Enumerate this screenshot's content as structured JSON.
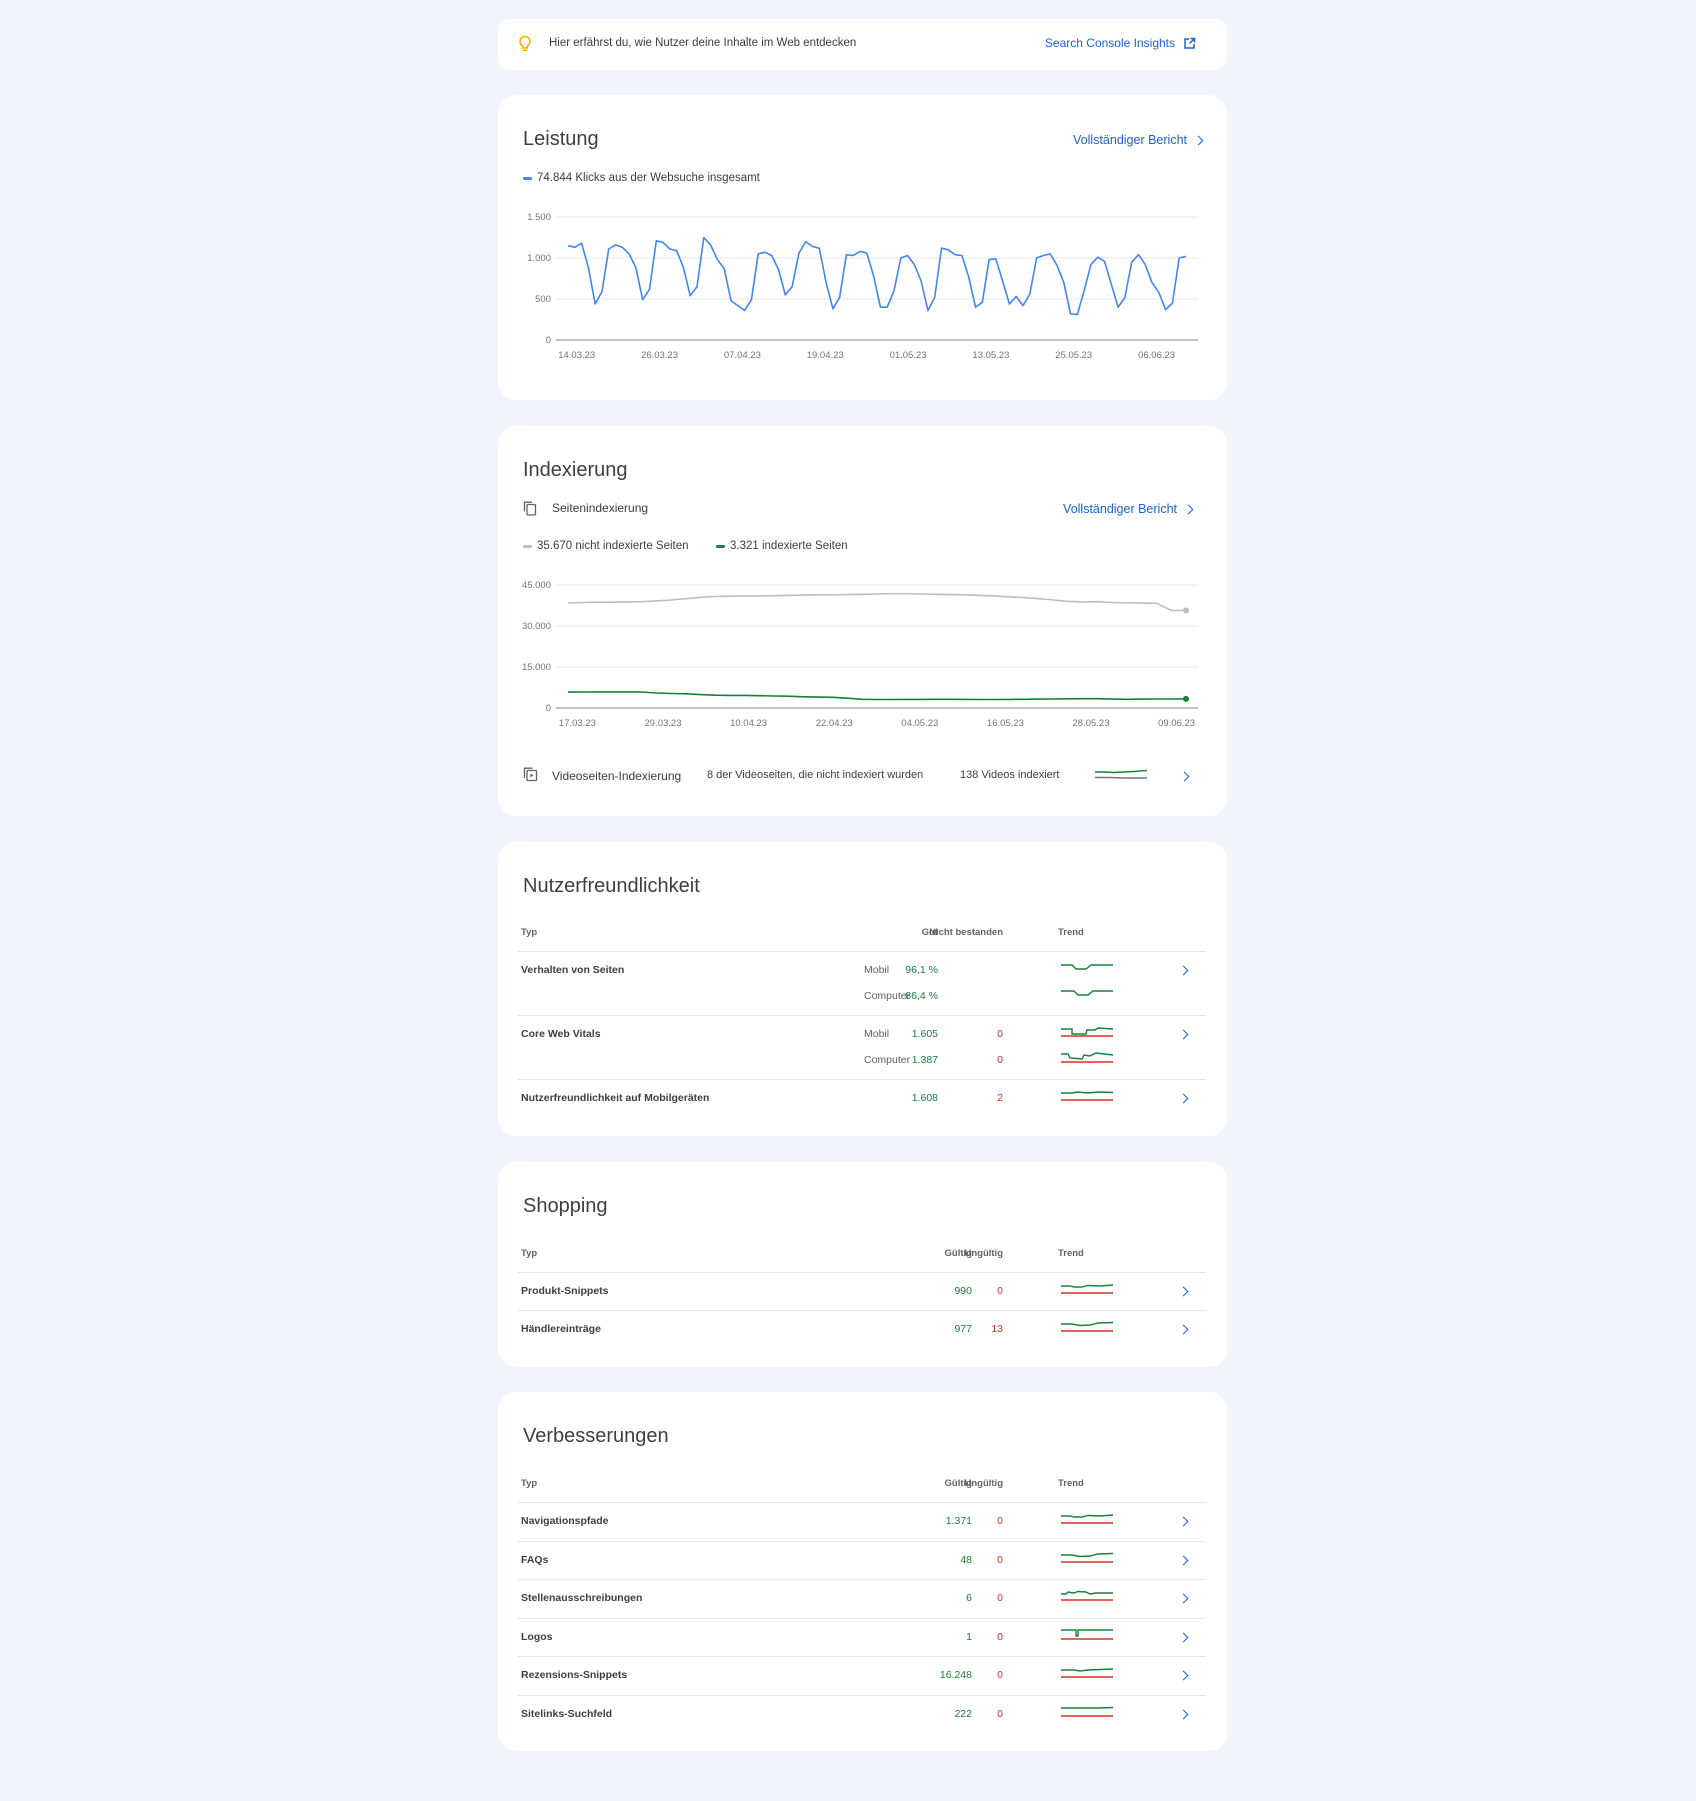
{
  "insights_banner": {
    "text": "Hier erfährst du, wie Nutzer deine Inhalte im Web entdecken",
    "link": "Search Console Insights",
    "icon": "lightbulb-icon"
  },
  "performance": {
    "title": "Leistung",
    "full_report": "Vollständiger Bericht",
    "legend": "74.844 Klicks aus der Websuche insgesamt",
    "series_color": "#4285f4",
    "chart_data": {
      "type": "line",
      "ylim": [
        0,
        1500
      ],
      "y_ticks": [
        "0",
        "500",
        "1.000",
        "1.500"
      ],
      "x_ticks": [
        "14.03.23",
        "26.03.23",
        "07.04.23",
        "19.04.23",
        "01.05.23",
        "13.05.23",
        "25.05.23",
        "06.06.23"
      ],
      "x_start": "11.03.23",
      "x_end": "12.06.23",
      "series": [
        {
          "name": "Klicks",
          "values": [
            1150,
            1130,
            1180,
            880,
            440,
            590,
            1110,
            1160,
            1130,
            1050,
            880,
            490,
            620,
            1210,
            1190,
            1110,
            1090,
            880,
            540,
            650,
            1250,
            1160,
            980,
            870,
            480,
            420,
            360,
            490,
            1050,
            1070,
            1030,
            860,
            550,
            650,
            1060,
            1200,
            1140,
            1120,
            700,
            380,
            520,
            1040,
            1030,
            1080,
            1060,
            780,
            400,
            400,
            600,
            1000,
            1030,
            920,
            720,
            360,
            520,
            1120,
            1100,
            1040,
            1030,
            770,
            400,
            460,
            980,
            990,
            720,
            440,
            530,
            420,
            560,
            1000,
            1030,
            1050,
            910,
            700,
            320,
            310,
            600,
            920,
            1010,
            960,
            680,
            400,
            520,
            950,
            1040,
            920,
            700,
            580,
            370,
            450,
            1000,
            1020
          ]
        }
      ]
    }
  },
  "indexing": {
    "title": "Indexierung",
    "page_indexing": "Seitenindexierung",
    "full_report": "Vollständiger Bericht",
    "legend_not_indexed": "35.670 nicht indexierte Seiten",
    "legend_indexed": "3.321 indexierte Seiten",
    "color_not_indexed": "#bdbdbd",
    "color_indexed": "#188038",
    "chart_data": {
      "type": "line",
      "ylim": [
        0,
        45000
      ],
      "y_ticks": [
        "0",
        "15.000",
        "30.000",
        "45.000"
      ],
      "x_ticks": [
        "17.03.23",
        "29.03.23",
        "10.04.23",
        "22.04.23",
        "04.05.23",
        "16.05.23",
        "28.05.23",
        "09.06.23"
      ],
      "x_start": "14.03.23",
      "x_end": "12.06.23",
      "series": [
        {
          "name": "Nicht indexiert",
          "values": [
            38500,
            38600,
            38700,
            38700,
            38800,
            38900,
            39200,
            39500,
            40000,
            40500,
            40800,
            40900,
            41000,
            41000,
            41100,
            41200,
            41300,
            41400,
            41400,
            41500,
            41600,
            41700,
            41800,
            41800,
            41700,
            41600,
            41500,
            41400,
            41200,
            41000,
            40700,
            40400,
            40000,
            39500,
            39000,
            38800,
            38900,
            38600,
            38500,
            38400,
            38300,
            35700,
            35670
          ]
        },
        {
          "name": "Indexiert",
          "values": [
            5800,
            5850,
            5900,
            5900,
            5900,
            5850,
            5500,
            5300,
            5200,
            4900,
            4700,
            4600,
            4600,
            4500,
            4400,
            4300,
            4100,
            4000,
            3900,
            3600,
            3200,
            3100,
            3100,
            3150,
            3150,
            3200,
            3200,
            3150,
            3100,
            3100,
            3150,
            3200,
            3250,
            3300,
            3350,
            3400,
            3400,
            3250,
            3200,
            3250,
            3300,
            3300,
            3321
          ]
        }
      ]
    },
    "video": {
      "label": "Videoseiten-Indexierung",
      "not_indexed": "8 der Videoseiten, die nicht indexiert wurden",
      "indexed": "138 Videos indexiert"
    }
  },
  "usability": {
    "title": "Nutzerfreundlichkeit",
    "headers": {
      "type": "Typ",
      "good": "Gut",
      "failed": "Nicht bestanden",
      "trend": "Trend"
    },
    "rows": [
      {
        "label": "Verhalten von Seiten",
        "mobile_label": "Mobil",
        "mobile_good": "96,1 %",
        "desktop_label": "Computer",
        "desktop_good": "86,4 %"
      },
      {
        "label": "Core Web Vitals",
        "mobile_label": "Mobil",
        "mobile_good": "1.605",
        "mobile_failed": "0",
        "desktop_label": "Computer",
        "desktop_good": "1.387",
        "desktop_failed": "0"
      },
      {
        "label": "Nutzerfreundlichkeit auf Mobilgeräten",
        "good": "1.608",
        "failed": "2"
      }
    ]
  },
  "shopping": {
    "title": "Shopping",
    "headers": {
      "type": "Typ",
      "valid": "Gültig",
      "invalid": "Ungültig",
      "trend": "Trend"
    },
    "rows": [
      {
        "label": "Produkt-Snippets",
        "valid": "990",
        "invalid": "0"
      },
      {
        "label": "Händlereinträge",
        "valid": "977",
        "invalid": "13"
      }
    ]
  },
  "enhancements": {
    "title": "Verbesserungen",
    "headers": {
      "type": "Typ",
      "valid": "Gültig",
      "invalid": "Ungültig",
      "trend": "Trend"
    },
    "rows": [
      {
        "label": "Navigationspfade",
        "valid": "1.371",
        "invalid": "0"
      },
      {
        "label": "FAQs",
        "valid": "48",
        "invalid": "0"
      },
      {
        "label": "Stellenausschreibungen",
        "valid": "6",
        "invalid": "0"
      },
      {
        "label": "Logos",
        "valid": "1",
        "invalid": "0"
      },
      {
        "label": "Rezensions-Snippets",
        "valid": "16.248",
        "invalid": "0"
      },
      {
        "label": "Sitelinks-Suchfeld",
        "valid": "222",
        "invalid": "0"
      }
    ]
  },
  "colors": {
    "good": "#188038",
    "bad": "#d93025",
    "link": "#1a62d0"
  }
}
